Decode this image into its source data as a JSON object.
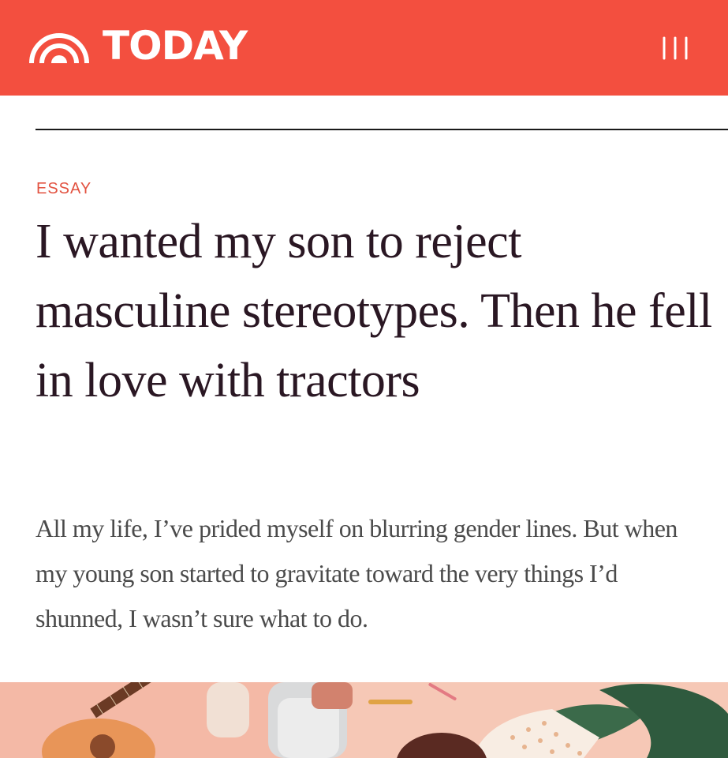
{
  "header": {
    "brand": "TODAY",
    "logo_icon": "today-sunrise-icon",
    "menu_icon": "hamburger-menu-icon",
    "background_color": "#f34f3f"
  },
  "article": {
    "kicker": "ESSAY",
    "kicker_color": "#e25240",
    "headline": "I wanted my son to reject masculine stereotypes. Then he fell in love with tractors",
    "dek": "All my life, I’ve prided myself on blurring gender lines. But when my young son started to gravitate toward the very things I’d shunned, I wasn’t sure what to do."
  },
  "hero_image": {
    "subject": "illustration with guitar, sneakers and pencils"
  }
}
